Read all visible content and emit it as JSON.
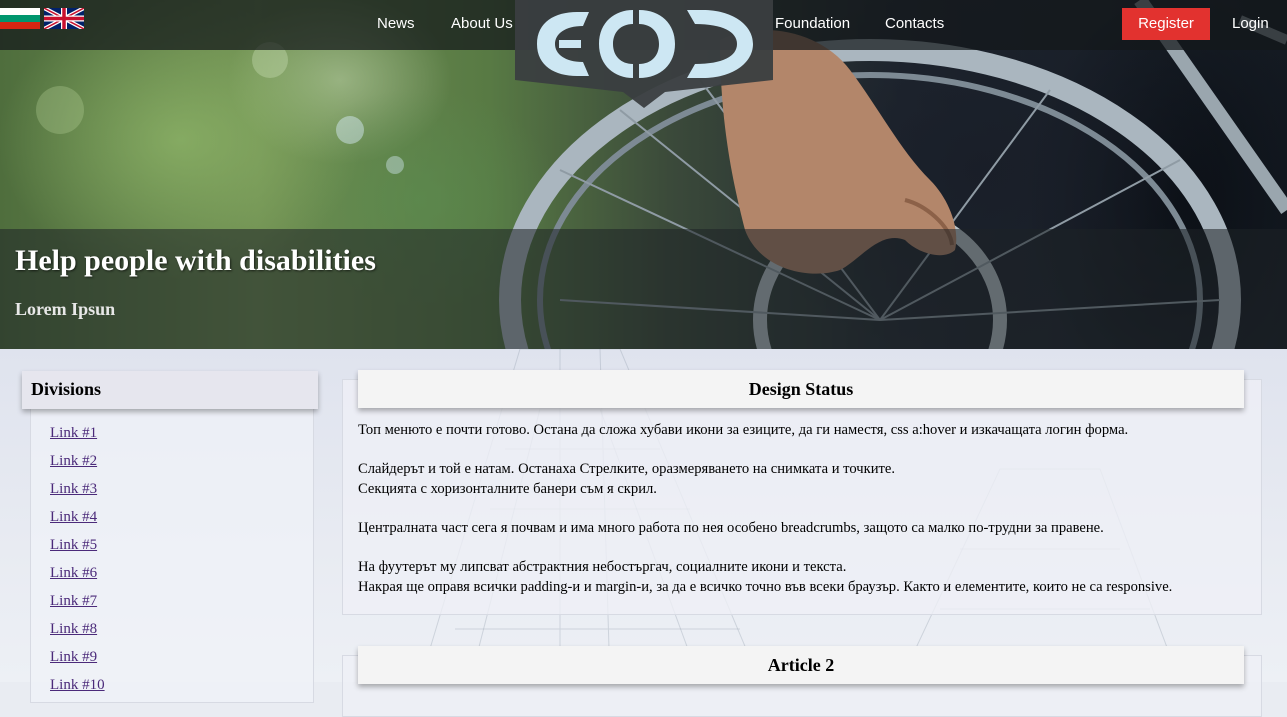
{
  "header": {
    "nav_left": [
      "News",
      "About Us"
    ],
    "nav_right": [
      "Foundation",
      "Contacts"
    ],
    "register_label": "Register",
    "login_label": "Login",
    "flags": [
      "bulgarian-flag-icon",
      "uk-flag-icon"
    ],
    "logo_icon": "ecod-logo"
  },
  "hero": {
    "title": "Help people with disabilities",
    "subtitle": "Lorem Ipsun"
  },
  "sidebar": {
    "title": "Divisions",
    "links": [
      "Link #1",
      "Link #2",
      "Link #3",
      "Link #4",
      "Link #5",
      "Link #6",
      "Link #7",
      "Link #8",
      "Link #9",
      "Link #10"
    ]
  },
  "articles": [
    {
      "title": "Design Status",
      "lines": [
        "Топ менюто е почти готово. Остана да сложа хубави икони за езиците, да ги наместя, css a:hover и изкачащата логин форма.",
        "",
        "Слайдерът и той е натам. Останаха Стрелките, оразмеряването на снимката и точките.",
        "Секцията с хоризонталните банери съм я скрил.",
        "",
        "Централната част сега я почвам и има много работа по нея особено breadcrumbs, защото са малко по-трудни за правене.",
        "",
        "На фуутерът му липсват абстрактния небостъргач, социалните икони и текста.",
        "Накрая ще оправя всички padding-и и margin-и, за да е всичко точно във всеки браузър. Както и елементите, които не са responsive."
      ]
    },
    {
      "title": "Article 2"
    }
  ],
  "colors": {
    "register_button": "#e2322f",
    "link_color": "#4b2a7a",
    "logo_fill": "#cde7f3"
  }
}
